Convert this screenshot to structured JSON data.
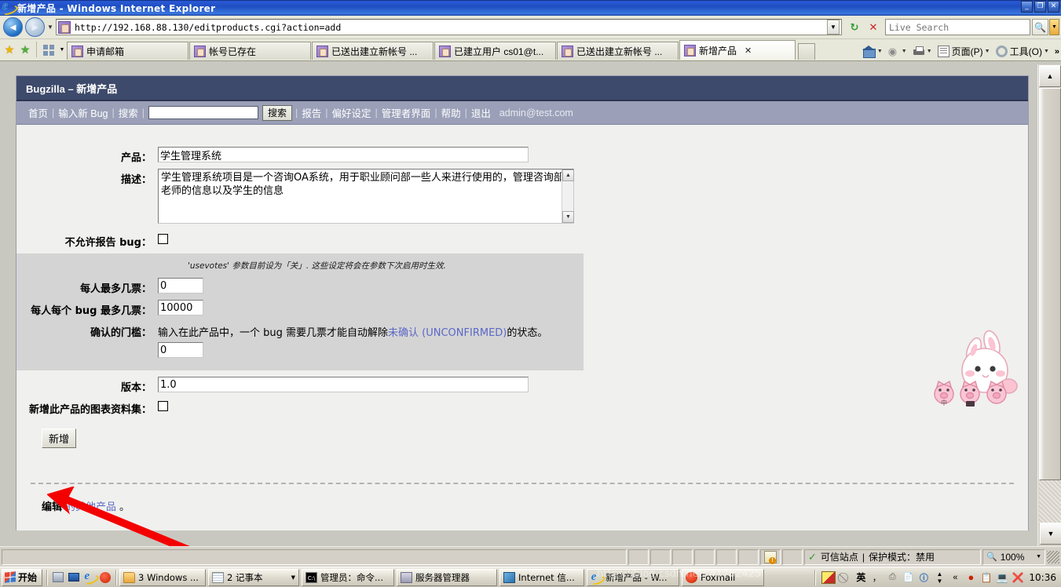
{
  "window": {
    "title": "新增产品 - Windows Internet Explorer",
    "icon": "ie-logo-icon",
    "minimize": "_",
    "maximize": "❐",
    "close": "✕"
  },
  "navbar": {
    "back_icon": "◄",
    "forward_icon": "►",
    "history_caret": "▼",
    "url": "http://192.168.88.130/editproducts.cgi?action=add",
    "url_dropdown": "▼",
    "refresh_icon": "↻",
    "stop_icon": "✕",
    "search_placeholder": "Live Search",
    "search_value": "",
    "search_go_icon": "search-icon",
    "search_dropdown": "▼"
  },
  "tabs": {
    "favorites_star": "★",
    "add_favorites_star": "★",
    "quick_tabs_caret": "▼",
    "items": [
      {
        "label": "申请邮箱",
        "active": false,
        "icon": "ie-page-icon"
      },
      {
        "label": "帐号已存在",
        "active": false,
        "icon": "page-icon"
      },
      {
        "label": "已送出建立新帐号 ...",
        "active": false,
        "icon": "page-icon"
      },
      {
        "label": "已建立用户 cs01@t...",
        "active": false,
        "icon": "page-icon"
      },
      {
        "label": "已送出建立新帐号 ...",
        "active": false,
        "icon": "page-icon"
      },
      {
        "label": "新增产品",
        "active": true,
        "icon": "page-icon",
        "close": "✕"
      }
    ]
  },
  "toolbar_right": {
    "home_label": "",
    "feeds_label": "",
    "print_label": "",
    "page_label": "页面(P)",
    "tools_label": "工具(O)",
    "caret": "▼",
    "overflow": "»"
  },
  "bugzilla": {
    "header_title": "Bugzilla – 新增产品",
    "nav": {
      "home": "首页",
      "new_bug": "输入新 Bug",
      "search": "搜索",
      "search_value": "",
      "search_button": "搜索",
      "reports": "报告",
      "preferences": "偏好设定",
      "admin": "管理者界面",
      "help": "帮助",
      "logout": "退出",
      "user": "admin@test.com",
      "separator": "|"
    },
    "form": {
      "product_label": "产品：",
      "product_value": "学生管理系统",
      "description_label": "描述：",
      "description_value": "学生管理系统项目是一个咨询OA系统，用于职业顾问部一些人来进行使用的，管理咨询部老师的信息以及学生的信息",
      "closed_label": "不允许许报告 bug：",
      "closed_label_text": "不允许报告 bug：",
      "closed_checked": false,
      "votes_note": "'usevotes' 参数目前设为「关」. 这些设定将会在参数下次启用时生效.",
      "votes_per_user_label": "每人最多几票：",
      "votes_per_user_value": "0",
      "votes_per_bug_label": "每人每个 bug 最多几票：",
      "votes_per_bug_value": "10000",
      "confirm_label": "确认的门槛：",
      "confirm_text_1": "输入在此产品中，一个 bug 需要几票才能自动解除",
      "confirm_link_1": "未确认",
      "confirm_link_2": "(UNCONFIRMED)",
      "confirm_text_2": "的状态。",
      "confirm_value": "0",
      "version_label": "版本：",
      "version_value": "1.0",
      "chart_label": "新增此产品的图表资料集：",
      "chart_checked": false,
      "submit_button": "新增"
    },
    "footer": {
      "edit_text": "编辑",
      "edit_link": "的其他产品",
      "period": "。"
    },
    "scrollbar": {
      "up": "▲",
      "down": "▼"
    }
  },
  "statusbar": {
    "message": "",
    "zone_icon": "check-icon",
    "zone_text": "可信站点",
    "separator": "|",
    "protected_mode": "保护模式：禁用",
    "zoom_icon": "magnifier-icon",
    "zoom_level": "100%",
    "zoom_caret": "▼"
  },
  "taskbar": {
    "start": "开始",
    "quick_launch": [
      "remote-desktop-icon",
      "show-desktop-icon",
      "ie-icon",
      "foxmail-icon"
    ],
    "items": [
      {
        "label": "3 Windows ...",
        "icon": "folder-icon",
        "caret": "▼",
        "grouped": true
      },
      {
        "label": "2 记事本",
        "icon": "notepad-icon",
        "caret": "▼",
        "grouped": true
      },
      {
        "label": "管理员：命令...",
        "icon": "cmd-icon",
        "grouped": false
      },
      {
        "label": "服务器管理器",
        "icon": "server-manager-icon",
        "grouped": false
      },
      {
        "label": "Internet 信...",
        "icon": "iis-icon",
        "grouped": false
      },
      {
        "label": "新增产品 - W...",
        "icon": "ie-icon",
        "grouped": false,
        "active": true
      },
      {
        "label": "Foxmail",
        "icon": "foxmail-icon",
        "grouped": false
      }
    ],
    "tray": {
      "ime_mode": "英",
      "ime_punct": "，",
      "expand": "«",
      "time": "10:36"
    }
  },
  "annotations": {
    "arrow_color": "#f40000",
    "arrow_target": "submit-button"
  },
  "sticker": {
    "name": "bunny-and-pigs-sticker",
    "pig_labels": [
      "中",
      ""
    ]
  },
  "watermark": "https://blog.csdn.net/ 41782425"
}
